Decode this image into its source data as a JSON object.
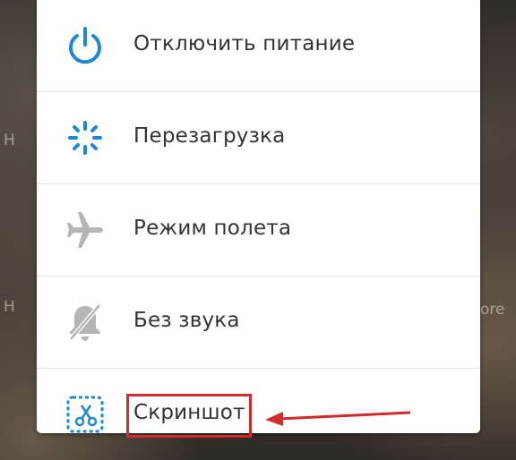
{
  "background": {
    "left_text_1": "H",
    "left_text_2": "H",
    "right_text": "ore"
  },
  "power_menu": {
    "items": [
      {
        "label": "Отключить питание",
        "icon": "power-icon",
        "icon_color": "#1e88d6"
      },
      {
        "label": "Перезагрузка",
        "icon": "restart-spinner-icon",
        "icon_color": "#1e88d6"
      },
      {
        "label": "Режим полета",
        "icon": "airplane-icon",
        "icon_color": "#b5b5b5"
      },
      {
        "label": "Без звука",
        "icon": "bell-muted-icon",
        "icon_color": "#b5b5b5"
      },
      {
        "label": "Скриншот",
        "icon": "screenshot-scissors-icon",
        "icon_color": "#1e88d6"
      }
    ]
  },
  "annotation": {
    "highlight_color": "#d32b2b",
    "target": "Скриншот"
  }
}
